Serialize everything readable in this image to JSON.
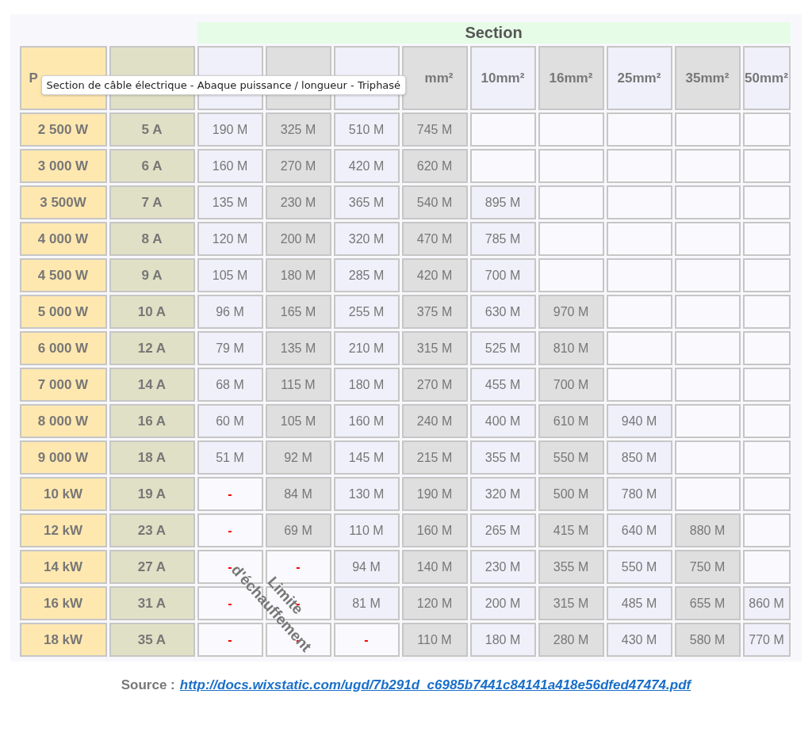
{
  "table": {
    "section_title": "Section",
    "columns": [
      {
        "label": "P",
        "kind": "power"
      },
      {
        "kind": "current"
      },
      {
        "kind": "light"
      },
      {
        "kind": "gray"
      },
      {
        "kind": "light"
      },
      {
        "label": "mm²",
        "kind": "gray"
      },
      {
        "label": "10mm²",
        "kind": "light"
      },
      {
        "label": "16mm²",
        "kind": "gray"
      },
      {
        "label": "25mm²",
        "kind": "light"
      },
      {
        "label": "35mm²",
        "kind": "gray"
      },
      {
        "label": "50mm²",
        "kind": "light"
      }
    ],
    "rows": [
      {
        "cells": [
          "2 500 W",
          "5 A",
          "190 M",
          "325 M",
          "510 M",
          "745 M",
          "",
          "",
          "",
          "",
          ""
        ]
      },
      {
        "cells": [
          "3 000 W",
          "6 A",
          "160 M",
          "270 M",
          "420 M",
          "620 M",
          "",
          "",
          "",
          "",
          ""
        ]
      },
      {
        "cells": [
          "3 500W",
          "7 A",
          "135 M",
          "230 M",
          "365 M",
          "540 M",
          "895 M",
          "",
          "",
          "",
          ""
        ]
      },
      {
        "cells": [
          "4 000 W",
          "8 A",
          "120 M",
          "200 M",
          "320 M",
          "470 M",
          "785 M",
          "",
          "",
          "",
          ""
        ]
      },
      {
        "cells": [
          "4 500 W",
          "9 A",
          "105 M",
          "180 M",
          "285 M",
          "420 M",
          "700 M",
          "",
          "",
          "",
          ""
        ]
      },
      {
        "cells": [
          "5 000 W",
          "10 A",
          "96 M",
          "165 M",
          "255 M",
          "375 M",
          "630 M",
          "970 M",
          "",
          "",
          ""
        ]
      },
      {
        "cells": [
          "6 000 W",
          "12 A",
          "79 M",
          "135 M",
          "210 M",
          "315 M",
          "525 M",
          "810 M",
          "",
          "",
          ""
        ]
      },
      {
        "cells": [
          "7 000 W",
          "14 A",
          "68 M",
          "115 M",
          "180 M",
          "270 M",
          "455 M",
          "700 M",
          "",
          "",
          ""
        ]
      },
      {
        "cells": [
          "8 000 W",
          "16 A",
          "60 M",
          "105 M",
          "160 M",
          "240 M",
          "400 M",
          "610 M",
          "940 M",
          "",
          ""
        ]
      },
      {
        "cells": [
          "9 000 W",
          "18 A",
          "51 M",
          "92 M",
          "145 M",
          "215 M",
          "355 M",
          "550 M",
          "850 M",
          "",
          ""
        ]
      },
      {
        "cells": [
          "10 kW",
          "19 A",
          "-",
          "84 M",
          "130 M",
          "190 M",
          "320 M",
          "500 M",
          "780 M",
          "",
          ""
        ]
      },
      {
        "cells": [
          "12 kW",
          "23 A",
          "-",
          "69 M",
          "110 M",
          "160 M",
          "265 M",
          "415 M",
          "640 M",
          "880 M",
          ""
        ]
      },
      {
        "cells": [
          "14 kW",
          "27 A",
          "-",
          "-",
          "94 M",
          "140 M",
          "230 M",
          "355 M",
          "550 M",
          "750 M",
          ""
        ]
      },
      {
        "cells": [
          "16 kW",
          "31 A",
          "-",
          "-",
          "81 M",
          "120 M",
          "200 M",
          "315 M",
          "485 M",
          "655 M",
          "860 M"
        ]
      },
      {
        "cells": [
          "18 kW",
          "35 A",
          "-",
          "-",
          "-",
          "110 M",
          "180 M",
          "280 M",
          "430 M",
          "580 M",
          "770 M"
        ]
      }
    ],
    "annotation": "Limite d'échauffement"
  },
  "tooltip": "Section de câble électrique - Abaque puissance / longueur - Triphasé",
  "source": {
    "label": "Source :",
    "link": "http://docs.wixstatic.com/ugd/7b291d_c6985b7441c84141a418e56dfed47474.pdf"
  }
}
